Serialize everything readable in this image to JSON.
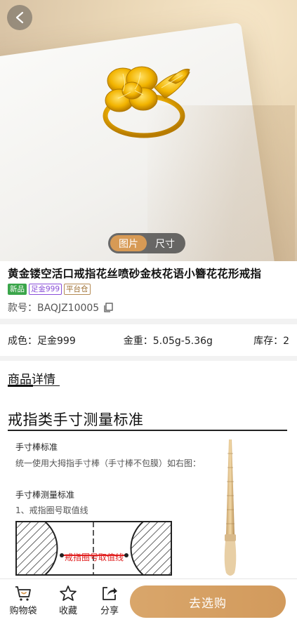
{
  "gallery": {
    "tabs": [
      "图片",
      "尺寸"
    ],
    "active_tab": 0
  },
  "product": {
    "title": "黄金镂空活口戒指花丝喷砂金枝花语小簪花花形戒指",
    "tags": [
      "新品",
      "足金999",
      "平台仓"
    ],
    "sku_label": "款号：",
    "sku_value": "BAQJZ10005"
  },
  "specs": {
    "color": "成色：足金999",
    "weight": "金重：5.05g-5.36g",
    "stock": "库存：2"
  },
  "details": {
    "heading": "商品详情",
    "section_title": "戒指类手寸测量标准",
    "stick_std_title": "手寸棒标准",
    "stick_std_text": "统一使用大拇指手寸棒（手寸棒不包膜）如右图：",
    "measure_title": "手寸棒测量标准",
    "measure_item": "1、戒指圈号取值线",
    "diagram_label": "戒指圈号取值线"
  },
  "bottom_bar": {
    "bag": "购物袋",
    "favorite": "收藏",
    "share": "分享",
    "buy": "去选购"
  },
  "colors": {
    "accent": "#d79a55",
    "new_tag": "#3aa54a",
    "gold_tag": "#8a4fd8"
  }
}
